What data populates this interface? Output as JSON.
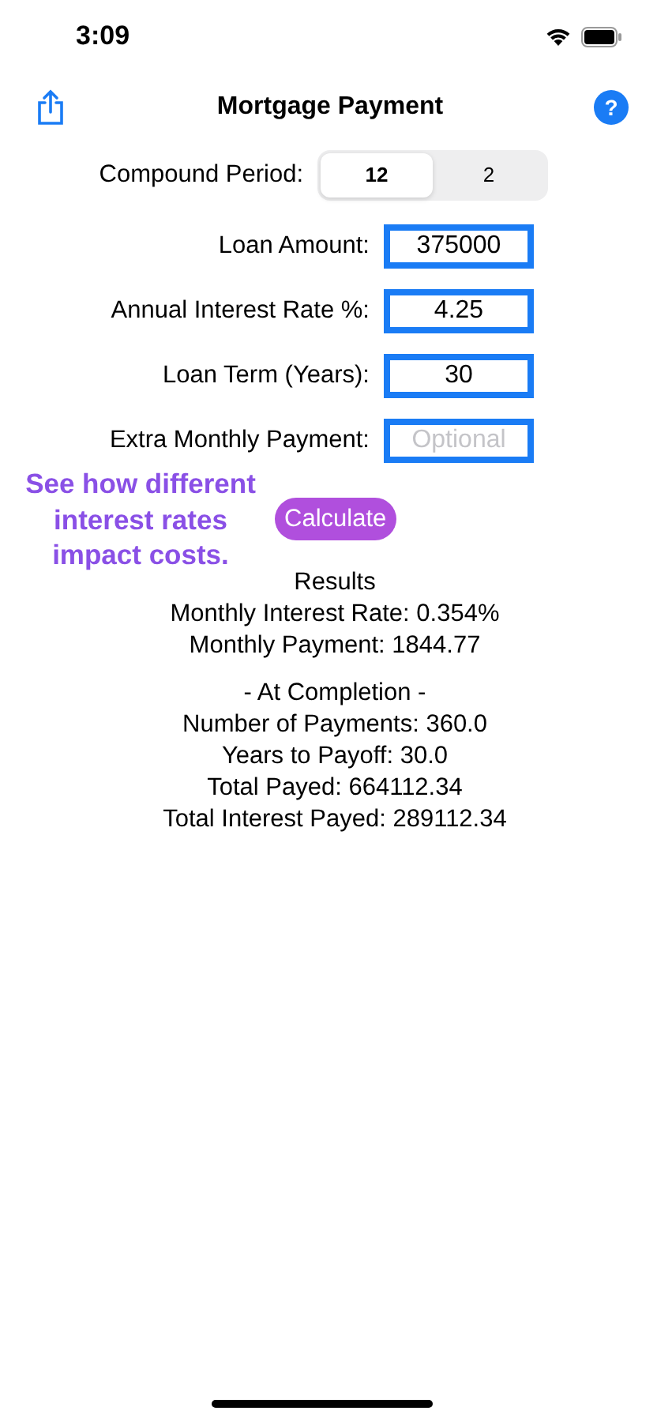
{
  "status_bar": {
    "time": "3:09"
  },
  "nav": {
    "title": "Mortgage Payment",
    "help": "?"
  },
  "compound_period": {
    "label": "Compound Period:",
    "segments": [
      {
        "label": "12",
        "selected": true
      },
      {
        "label": "2",
        "selected": false
      }
    ]
  },
  "fields": [
    {
      "label": "Loan Amount:",
      "value": "375000"
    },
    {
      "label": "Annual Interest Rate %:",
      "value": "4.25"
    },
    {
      "label": "Loan Term (Years):",
      "value": "30"
    },
    {
      "label": "Extra Monthly Payment:",
      "placeholder": "Optional"
    }
  ],
  "hint": "See how different interest rates impact costs.",
  "calculate_button": "Calculate",
  "results": {
    "title": "Results",
    "lines": [
      "Monthly Interest Rate: 0.354%",
      "Monthly Payment: 1844.77"
    ]
  },
  "completion": {
    "title": "- At Completion -",
    "lines": [
      "Number of Payments: 360.0",
      "Years to Payoff: 30.0",
      "Total Payed: 664112.34",
      "Total Interest Payed: 289112.34"
    ]
  }
}
